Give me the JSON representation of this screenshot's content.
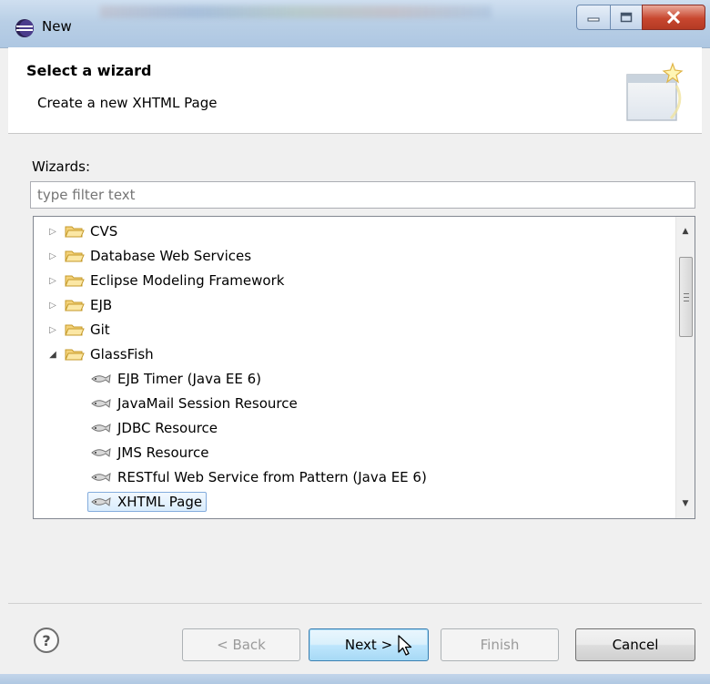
{
  "window": {
    "title": "New"
  },
  "header": {
    "title": "Select a wizard",
    "description": "Create a new XHTML Page"
  },
  "wizards_label": "Wizards:",
  "filter": {
    "placeholder": "type filter text",
    "value": ""
  },
  "tree": {
    "items": [
      {
        "label": "CVS",
        "type": "folder",
        "expanded": false,
        "level": 0
      },
      {
        "label": "Database Web Services",
        "type": "folder",
        "expanded": false,
        "level": 0
      },
      {
        "label": "Eclipse Modeling Framework",
        "type": "folder",
        "expanded": false,
        "level": 0
      },
      {
        "label": "EJB",
        "type": "folder",
        "expanded": false,
        "level": 0
      },
      {
        "label": "Git",
        "type": "folder",
        "expanded": false,
        "level": 0
      },
      {
        "label": "GlassFish",
        "type": "folder",
        "expanded": true,
        "level": 0
      },
      {
        "label": "EJB Timer (Java EE 6)",
        "type": "wizard",
        "level": 1
      },
      {
        "label": "JavaMail Session Resource",
        "type": "wizard",
        "level": 1
      },
      {
        "label": "JDBC Resource",
        "type": "wizard",
        "level": 1
      },
      {
        "label": "JMS Resource",
        "type": "wizard",
        "level": 1
      },
      {
        "label": "RESTful Web Service from Pattern (Java EE 6)",
        "type": "wizard",
        "level": 1
      },
      {
        "label": "XHTML Page",
        "type": "wizard",
        "level": 1,
        "selected": true
      }
    ]
  },
  "buttons": {
    "back": "< Back",
    "next": "Next >",
    "finish": "Finish",
    "cancel": "Cancel",
    "help": "?"
  },
  "colors": {
    "titlebar": "#b9cfe6",
    "selection_border": "#84acdd",
    "default_button": "#bee6fd",
    "close_button": "#c8472f"
  },
  "icons": {
    "app": "eclipse-icon",
    "folder": "folder-icon",
    "wizard": "glassfish-wizard-icon",
    "banner": "new-wizard-banner-icon"
  }
}
